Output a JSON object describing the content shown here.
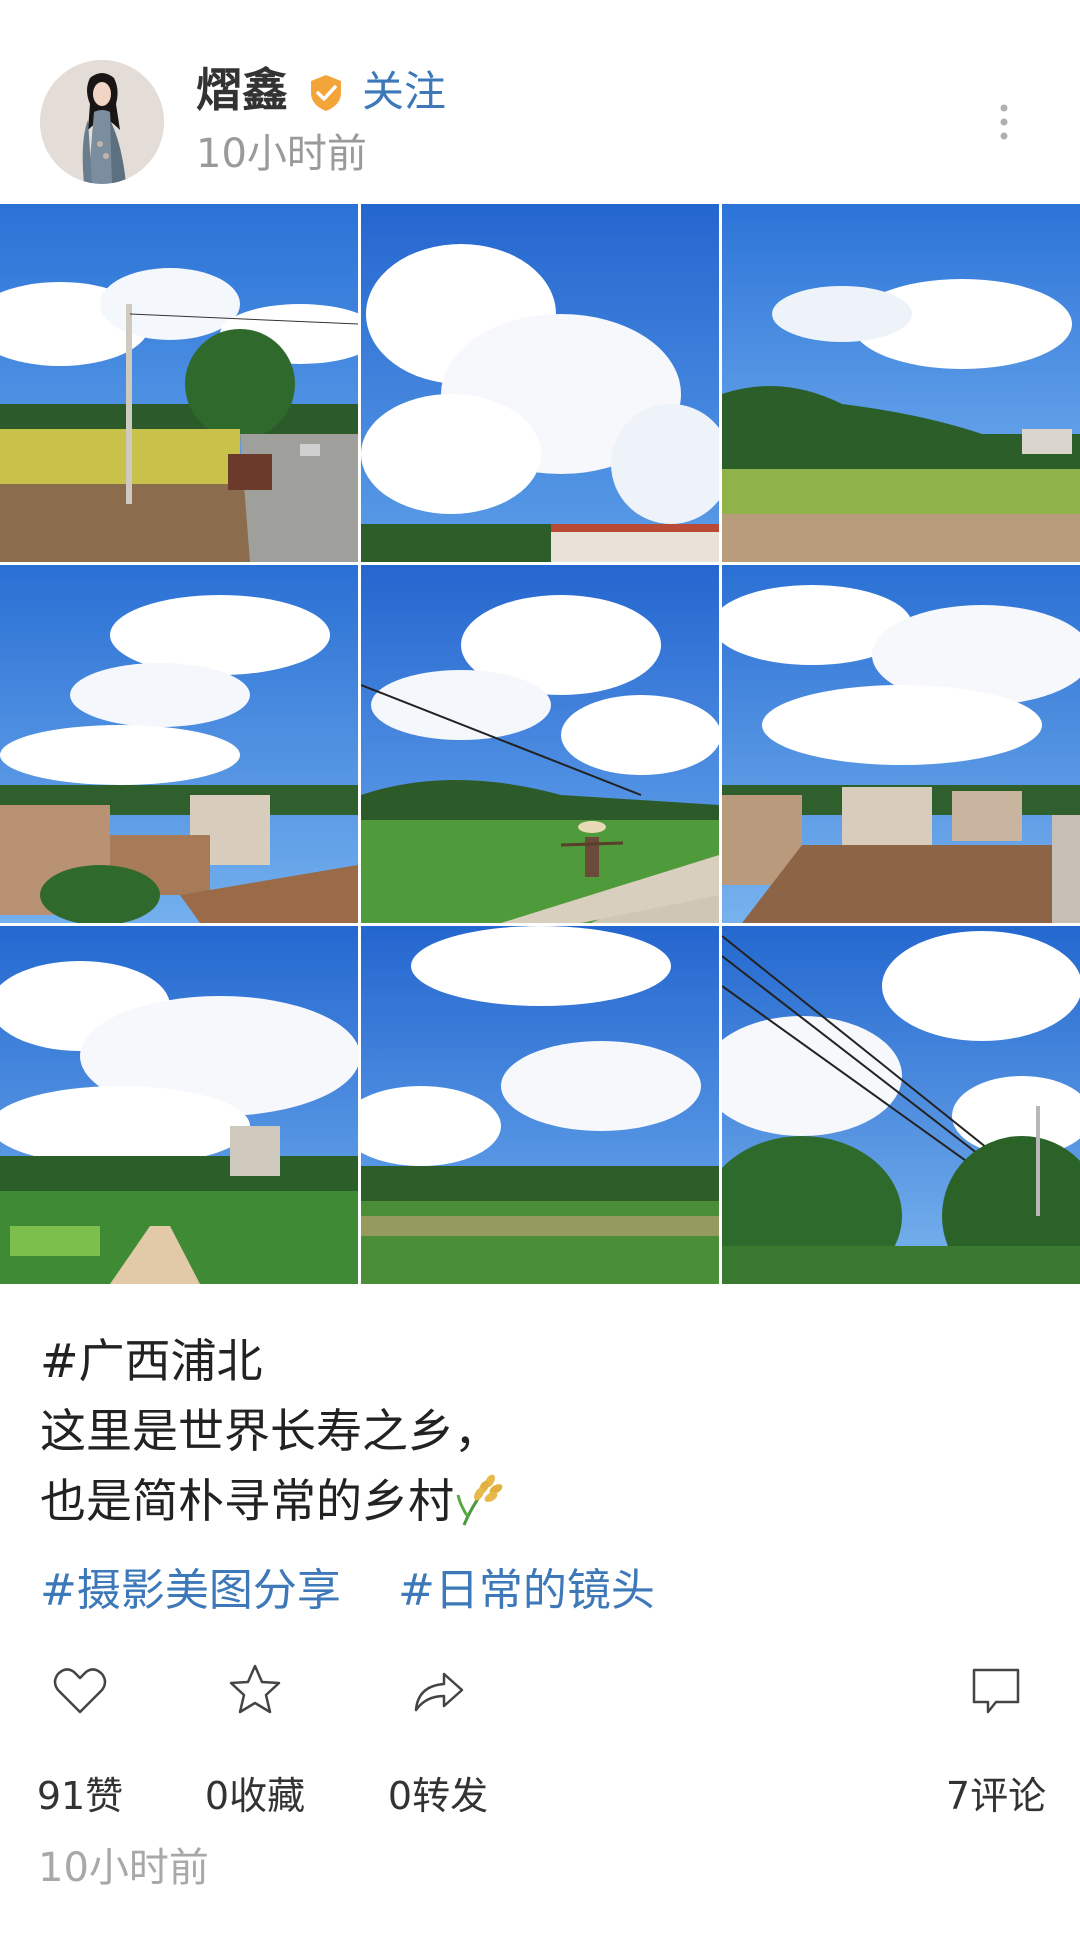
{
  "header": {
    "author_name": "熠鑫",
    "follow_label": "关注",
    "time": "10小时前",
    "verified_badge_icon": "verified-check-icon",
    "more_icon": "more-vertical-icon"
  },
  "photos": [
    {
      "scene": "country-road-with-power-pole"
    },
    {
      "scene": "cumulus-clouds-over-rooftop"
    },
    {
      "scene": "rice-field-and-hills"
    },
    {
      "scene": "village-rooftops-under-clouds"
    },
    {
      "scene": "farmer-with-shoulder-pole-on-road"
    },
    {
      "scene": "village-houses-and-clouds"
    },
    {
      "scene": "village-lane-with-green-fields"
    },
    {
      "scene": "crop-field-and-trees"
    },
    {
      "scene": "power-lines-and-trees"
    }
  ],
  "caption": {
    "line1": "#广西浦北",
    "line2": "这里是世界长寿之乡，",
    "line3": "也是简朴寻常的乡村",
    "emoji_icon": "rice-ear-icon"
  },
  "tags": [
    "#摄影美图分享",
    "#日常的镜头"
  ],
  "actions": {
    "like": {
      "icon": "heart-icon",
      "count_label": "91赞"
    },
    "favorite": {
      "icon": "star-icon",
      "count_label": "0收藏"
    },
    "share": {
      "icon": "share-arrow-icon",
      "count_label": "0转发"
    },
    "comment": {
      "icon": "comment-bubble-icon",
      "count_label": "7评论"
    }
  },
  "footer": {
    "time": "10小时前"
  },
  "colors": {
    "link_blue": "#3d78b8",
    "badge_orange": "#f4a53a",
    "muted_gray": "#9a9a9a",
    "sky_blue": "#2f7fe0"
  }
}
